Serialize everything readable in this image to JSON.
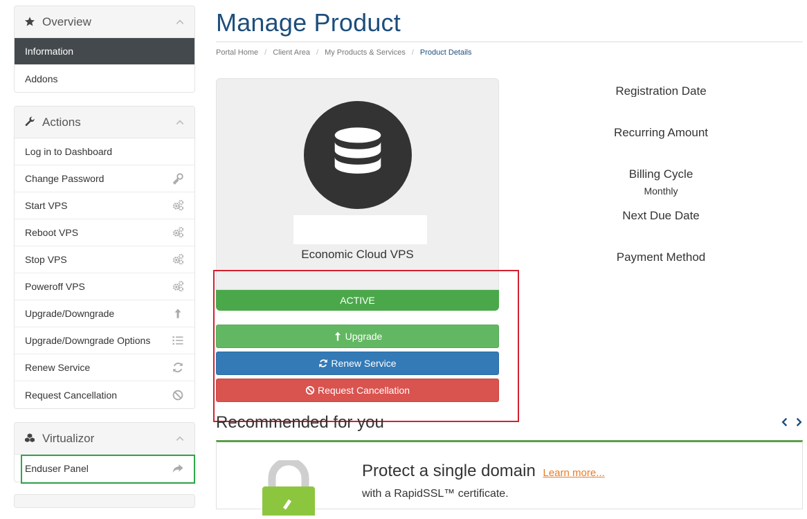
{
  "sidebar": {
    "overview": {
      "title": "Overview",
      "items": [
        {
          "label": "Information",
          "active": true
        },
        {
          "label": "Addons",
          "active": false
        }
      ]
    },
    "actions": {
      "title": "Actions",
      "items": [
        {
          "label": "Log in to Dashboard",
          "icon": ""
        },
        {
          "label": "Change Password",
          "icon": "key-icon"
        },
        {
          "label": "Start VPS",
          "icon": "cogs-icon"
        },
        {
          "label": "Reboot VPS",
          "icon": "cogs-icon"
        },
        {
          "label": "Stop VPS",
          "icon": "cogs-icon"
        },
        {
          "label": "Poweroff VPS",
          "icon": "cogs-icon"
        },
        {
          "label": "Upgrade/Downgrade",
          "icon": "arrow-up-icon"
        },
        {
          "label": "Upgrade/Downgrade Options",
          "icon": "list-icon"
        },
        {
          "label": "Renew Service",
          "icon": "refresh-icon"
        },
        {
          "label": "Request Cancellation",
          "icon": "ban-icon"
        }
      ]
    },
    "virtualizor": {
      "title": "Virtualizor",
      "items": [
        {
          "label": "Enduser Panel",
          "icon": "share-icon"
        }
      ]
    }
  },
  "main": {
    "title": "Manage Product",
    "breadcrumb": [
      "Portal Home",
      "Client Area",
      "My Products & Services",
      "Product Details"
    ],
    "product": {
      "name": "Economic Cloud VPS",
      "status": "ACTIVE",
      "icon": "database-icon"
    },
    "buttons": {
      "upgrade": "Upgrade",
      "renew": "Renew Service",
      "cancel": "Request Cancellation"
    },
    "details": [
      {
        "label": "Registration Date",
        "value": ""
      },
      {
        "label": "Recurring Amount",
        "value": ""
      },
      {
        "label": "Billing Cycle",
        "value": "Monthly"
      },
      {
        "label": "Next Due Date",
        "value": ""
      },
      {
        "label": "Payment Method",
        "value": ""
      }
    ],
    "recommended": {
      "title": "Recommended for you",
      "card_title": "Protect a single domain",
      "card_link": "Learn more...",
      "card_subtitle": "with a RapidSSL™ certificate."
    }
  },
  "colors": {
    "brand_blue": "#1d4e7c",
    "status_green": "#4aa84a",
    "upgrade_green": "#62b862",
    "renew_blue": "#337ab7",
    "cancel_red": "#d9534f",
    "highlight_red": "#d3202f",
    "highlight_green": "#2ea64a",
    "link_orange": "#e77b24"
  }
}
